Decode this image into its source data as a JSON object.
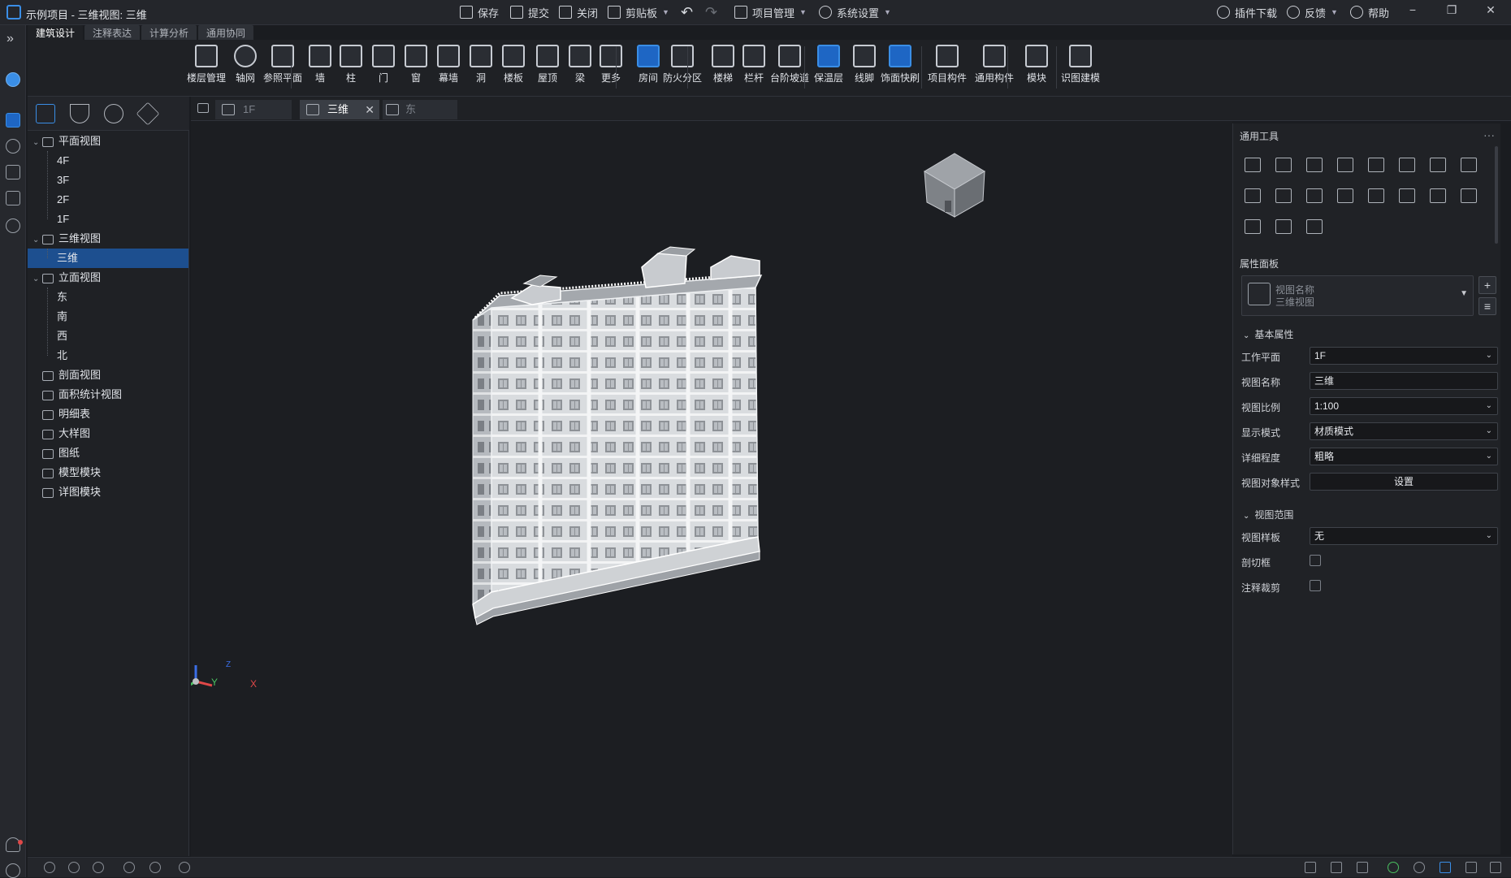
{
  "window": {
    "title": "示例项目 - 三维视图: 三维",
    "controls": [
      "−",
      "❐",
      "✕"
    ]
  },
  "quick_access": {
    "save": "保存",
    "submit": "提交",
    "close": "关闭",
    "clipboard": "剪贴板",
    "project_mgmt": "项目管理",
    "system_settings": "系统设置",
    "plugin_download": "插件下载",
    "feedback": "反馈",
    "help": "帮助"
  },
  "ribbon_tabs": [
    "建筑设计",
    "注释表达",
    "计算分析",
    "通用协同"
  ],
  "toolbar": {
    "items": [
      {
        "label": "楼层管理",
        "icon": "floor-manage-icon"
      },
      {
        "label": "轴网",
        "icon": "axis-grid-icon"
      },
      {
        "label": "参照平面",
        "icon": "ref-plane-icon"
      },
      {
        "label": "墙",
        "icon": "wall-icon"
      },
      {
        "label": "柱",
        "icon": "column-icon"
      },
      {
        "label": "门",
        "icon": "door-icon"
      },
      {
        "label": "窗",
        "icon": "window-icon"
      },
      {
        "label": "幕墙",
        "icon": "curtain-wall-icon"
      },
      {
        "label": "洞",
        "icon": "opening-icon"
      },
      {
        "label": "楼板",
        "icon": "slab-icon"
      },
      {
        "label": "屋顶",
        "icon": "roof-icon"
      },
      {
        "label": "梁",
        "icon": "beam-icon"
      },
      {
        "label": "更多",
        "icon": "more-icon"
      },
      {
        "label": "房间",
        "icon": "room-icon"
      },
      {
        "label": "防火分区",
        "icon": "fire-zone-icon"
      },
      {
        "label": "楼梯",
        "icon": "stair-icon"
      },
      {
        "label": "栏杆",
        "icon": "railing-icon"
      },
      {
        "label": "台阶坡道",
        "icon": "ramp-icon"
      },
      {
        "label": "保温层",
        "icon": "insulation-icon"
      },
      {
        "label": "线脚",
        "icon": "molding-icon"
      },
      {
        "label": "饰面快刷",
        "icon": "finish-brush-icon"
      },
      {
        "label": "项目构件",
        "icon": "project-component-icon"
      },
      {
        "label": "通用构件",
        "icon": "common-component-icon"
      },
      {
        "label": "模块",
        "icon": "module-icon"
      },
      {
        "label": "识图建模",
        "icon": "drawing-recognition-icon"
      }
    ]
  },
  "tree": {
    "nodes": [
      {
        "label": "平面视图",
        "level": 0,
        "expanded": true
      },
      {
        "label": "4F",
        "level": 1
      },
      {
        "label": "3F",
        "level": 1
      },
      {
        "label": "2F",
        "level": 1
      },
      {
        "label": "1F",
        "level": 1
      },
      {
        "label": "三维视图",
        "level": 0,
        "expanded": true
      },
      {
        "label": "三维",
        "level": 1,
        "selected": true
      },
      {
        "label": "立面视图",
        "level": 0,
        "expanded": true
      },
      {
        "label": "东",
        "level": 1
      },
      {
        "label": "南",
        "level": 1
      },
      {
        "label": "西",
        "level": 1
      },
      {
        "label": "北",
        "level": 1
      },
      {
        "label": "剖面视图",
        "level": 0
      },
      {
        "label": "面积统计视图",
        "level": 0
      },
      {
        "label": "明细表",
        "level": 0
      },
      {
        "label": "大样图",
        "level": 0
      },
      {
        "label": "图纸",
        "level": 0
      },
      {
        "label": "模型模块",
        "level": 0
      },
      {
        "label": "详图模块",
        "level": 0
      }
    ]
  },
  "doc_tabs": [
    {
      "label": "1F",
      "active": false
    },
    {
      "label": "三维",
      "active": true
    },
    {
      "label": "东",
      "active": false
    }
  ],
  "axis_labels": {
    "x": "X",
    "y": "Y",
    "z": "Z"
  },
  "right_panel": {
    "tools_title": "通用工具",
    "tools_more": "···",
    "properties_title": "属性面板",
    "view_card": {
      "name_label": "视图名称",
      "name_value": "三维视图"
    },
    "basic_group": "基本属性",
    "fields": [
      {
        "label": "工作平面",
        "value": "1F",
        "type": "select"
      },
      {
        "label": "视图名称",
        "value": "三维",
        "type": "text"
      },
      {
        "label": "视图比例",
        "value": "1:100",
        "type": "select"
      },
      {
        "label": "显示模式",
        "value": "材质模式",
        "type": "select"
      },
      {
        "label": "详细程度",
        "value": "粗略",
        "type": "select"
      },
      {
        "label": "视图对象样式",
        "value": "设置",
        "type": "button"
      }
    ],
    "range_group": "视图范围",
    "range_fields": [
      {
        "label": "视图样板",
        "value": "无",
        "type": "select"
      },
      {
        "label": "剖切框",
        "checked": false,
        "type": "checkbox"
      },
      {
        "label": "注释裁剪",
        "checked": false,
        "type": "checkbox"
      }
    ]
  },
  "colors": {
    "accent": "#3a8ee6",
    "selected_row": "#1d4f8f",
    "background": "#1c1e22"
  }
}
